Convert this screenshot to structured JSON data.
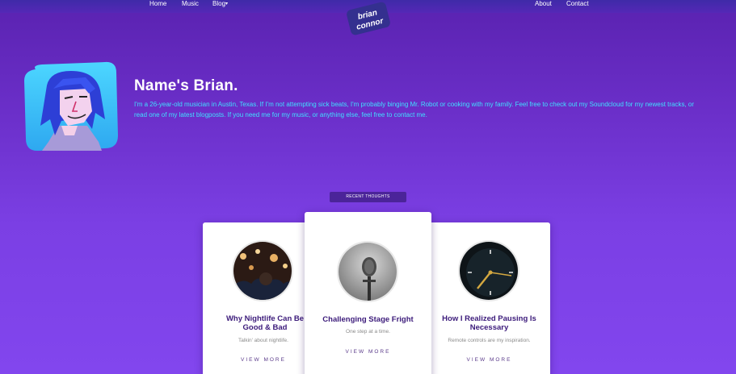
{
  "nav": {
    "left": [
      "Home",
      "Music",
      "Blog"
    ],
    "right": [
      "About",
      "Contact"
    ],
    "logo_text_line1": "brian",
    "logo_text_line2": "connor"
  },
  "hero": {
    "title": "Name's Brian.",
    "body": "I'm a 26-year-old musician in Austin, Texas. If I'm not attempting sick beats, I'm probably binging Mr. Robot or cooking with my family. Feel free to check out my Soundcloud for my newest tracks, or read one of my latest blogposts. If you need me for my music, or anything else, feel free to contact me."
  },
  "section": {
    "label": "Recent Thoughts"
  },
  "posts": [
    {
      "title": "Why Nightlife Can Be Good & Bad",
      "subtitle": "Talkin' about nightlife.",
      "more": "VIEW MORE",
      "image": "nightlife-photo"
    },
    {
      "title": "Challenging Stage Fright",
      "subtitle": "One step at a time.",
      "more": "VIEW MORE",
      "image": "microphone-photo"
    },
    {
      "title": "How I Realized Pausing Is Necessary",
      "subtitle": "Remote controls are my inspiration.",
      "more": "VIEW MORE",
      "image": "clock-photo"
    }
  ],
  "colors": {
    "accent": "#40e0ff",
    "background_top": "#5a22b0",
    "background_bottom": "#8246ee",
    "label_bg": "#4b2499",
    "card_title": "#3b1a7a"
  }
}
